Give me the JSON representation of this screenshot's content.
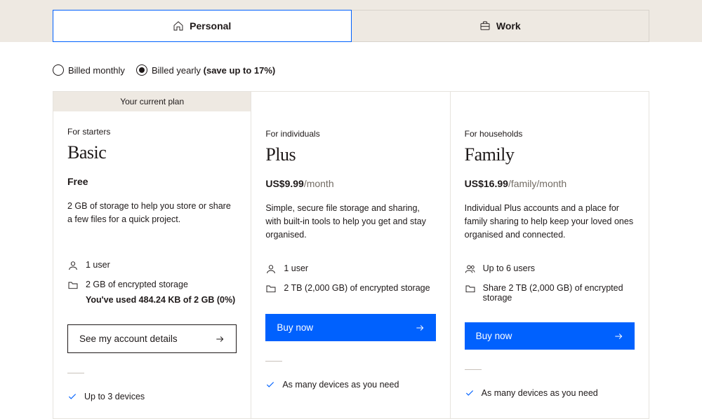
{
  "tabs": {
    "personal": "Personal",
    "work": "Work"
  },
  "billing": {
    "monthly": "Billed monthly",
    "yearly_prefix": "Billed yearly ",
    "yearly_save": "(save up to 17%)"
  },
  "plans": {
    "basic": {
      "banner": "Your current plan",
      "audience": "For starters",
      "name": "Basic",
      "price_amt": "Free",
      "price_per": "",
      "desc": "2 GB of storage to help you store or share a few files for a quick project.",
      "users": "1 user",
      "storage": "2 GB of encrypted storage",
      "usage": "You've used 484.24 KB of 2 GB (0%)",
      "cta": "See my account details",
      "feat1": "Up to 3 devices"
    },
    "plus": {
      "audience": "For individuals",
      "name": "Plus",
      "price_amt": "US$9.99",
      "price_per": "/month",
      "desc": "Simple, secure file storage and sharing, with built-in tools to help you get and stay organised.",
      "users": "1 user",
      "storage": "2 TB (2,000 GB) of encrypted storage",
      "cta": "Buy now",
      "feat1": "As many devices as you need"
    },
    "family": {
      "audience": "For households",
      "name": "Family",
      "price_amt": "US$16.99",
      "price_per": "/family/month",
      "desc": "Individual Plus accounts and a place for family sharing to help keep your loved ones organised and connected.",
      "users": "Up to 6 users",
      "storage": "Share 2 TB (2,000 GB) of encrypted storage",
      "cta": "Buy now",
      "feat1": "As many devices as you need"
    }
  }
}
